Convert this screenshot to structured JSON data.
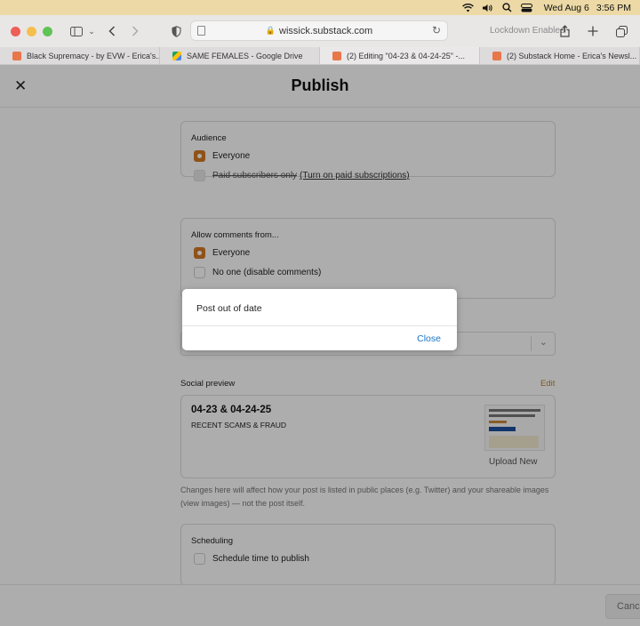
{
  "menubar": {
    "date": "Wed Aug 6",
    "time": "3:56 PM"
  },
  "browser": {
    "url": "wissick.substack.com",
    "lockdown_label": "Lockdown Enabled",
    "tabs": [
      {
        "title": "Black Supremacy - by EVW - Erica's..."
      },
      {
        "title": "SAME FEMALES - Google Drive"
      },
      {
        "title": "(2) Editing \"04-23 & 04-24-25\" -..."
      },
      {
        "title": "(2) Substack Home - Erica's Newsl..."
      }
    ]
  },
  "page": {
    "title": "Publish",
    "audience": {
      "label": "Audience",
      "option_everyone": "Everyone",
      "option_paid": "Paid subscribers only",
      "option_paid_link": "(Turn on paid subscriptions)"
    },
    "comments": {
      "label": "Allow comments from...",
      "option_everyone": "Everyone",
      "option_no_one": "No one (disable comments)"
    },
    "social_preview": {
      "label": "Social preview",
      "edit_label": "Edit",
      "post_title": "04-23 & 04-24-25",
      "post_subtitle": "RECENT SCAMS & FRAUD",
      "upload_label": "Upload New",
      "help_text": "Changes here will affect how your post is listed in public places (e.g. Twitter) and your shareable images (view images) — not the post itself."
    },
    "scheduling": {
      "label": "Scheduling",
      "option": "Schedule time to publish"
    },
    "footer": {
      "cancel_label": "Canc"
    }
  },
  "dialog": {
    "message": "Post out of date",
    "close_label": "Close"
  },
  "colors": {
    "accent": "#d47a26",
    "link": "#1a73c7"
  }
}
